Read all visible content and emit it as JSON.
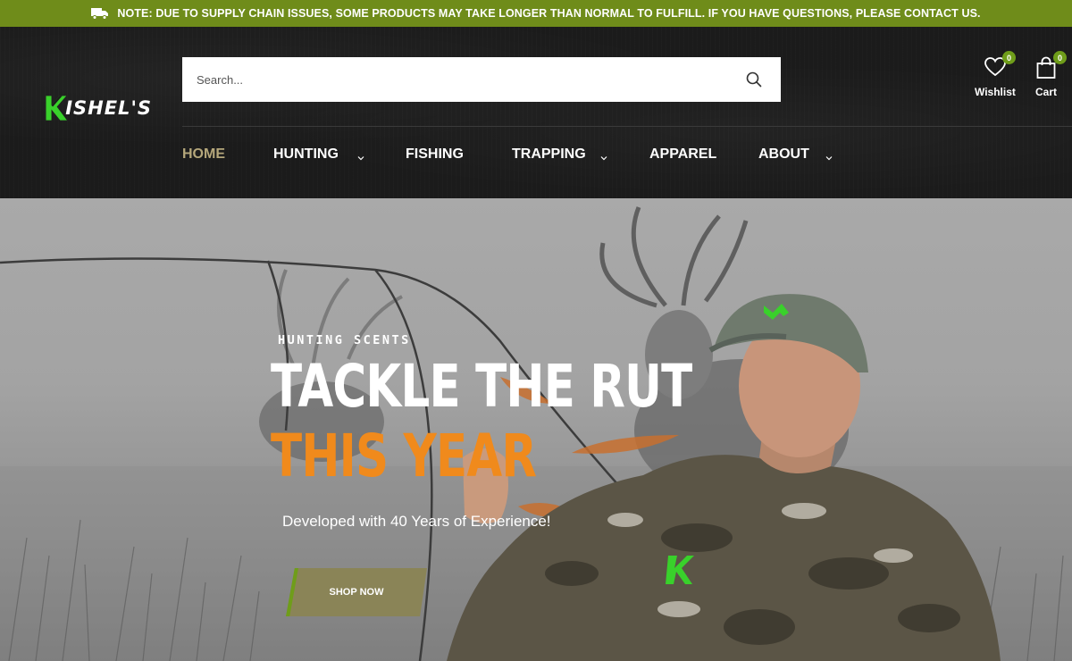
{
  "announcement": {
    "text": "NOTE: DUE TO SUPPLY CHAIN ISSUES, SOME PRODUCTS MAY TAKE LONGER THAN NORMAL TO FULFILL. IF YOU HAVE QUESTIONS, PLEASE CONTACT US.",
    "icon": "truck-icon",
    "bg_color": "#6f8c1a"
  },
  "brand": {
    "logo_letter": "K",
    "logo_text": "ISHEL'S",
    "accent_color": "#39d12b"
  },
  "search": {
    "placeholder": "Search...",
    "icon": "search-icon"
  },
  "header_actions": {
    "wishlist": {
      "label": "Wishlist",
      "count": "0",
      "icon": "heart-icon"
    },
    "cart": {
      "label": "Cart",
      "count": "0",
      "icon": "shopping-bag-icon"
    }
  },
  "nav": {
    "items": [
      {
        "label": "HOME",
        "active": true,
        "dropdown": false
      },
      {
        "label": "HUNTING",
        "active": false,
        "dropdown": true
      },
      {
        "label": "FISHING",
        "active": false,
        "dropdown": false
      },
      {
        "label": "TRAPPING",
        "active": false,
        "dropdown": true
      },
      {
        "label": "APPAREL",
        "active": false,
        "dropdown": false
      },
      {
        "label": "ABOUT",
        "active": false,
        "dropdown": true
      }
    ],
    "active_color": "#b5a77b"
  },
  "hero": {
    "eyebrow": "HUNTING SCENTS",
    "title_line1": "TACKLE THE RUT",
    "title_line2": "THIS YEAR",
    "subtitle": "Developed with 40 Years of Experience!",
    "cta_label": "SHOP NOW",
    "title_accent_color": "#f08a1c",
    "cta_color": "#8a8457"
  }
}
